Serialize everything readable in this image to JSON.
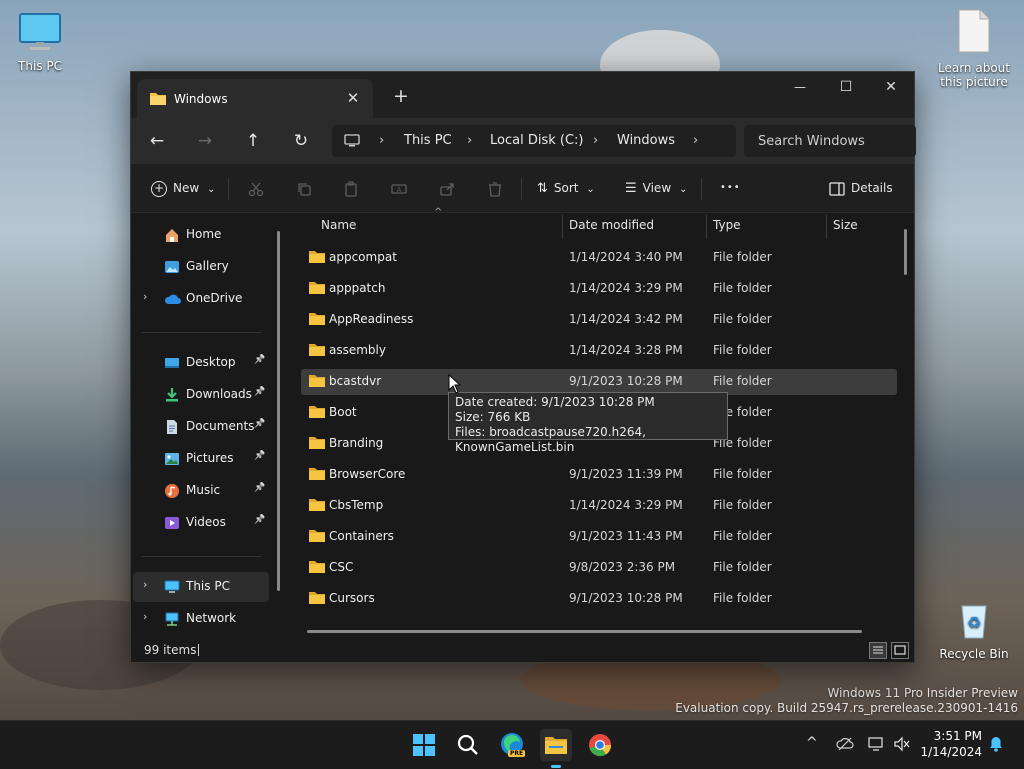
{
  "desktop": {
    "this_pc_label": "This PC",
    "learn_label": "Learn about this picture",
    "recycle_label": "Recycle Bin",
    "watermark_line1": "Windows 11 Pro Insider Preview",
    "watermark_line2": "Evaluation copy. Build 25947.rs_prerelease.230901-1416"
  },
  "window": {
    "tab_title": "Windows",
    "tab_close": "✕",
    "new_tab": "+",
    "minimize": "—",
    "maximize": "☐",
    "close": "✕"
  },
  "navbar": {
    "back": "←",
    "forward": "→",
    "up": "↑",
    "refresh": "↻",
    "breadcrumb": [
      "This PC",
      "Local Disk (C:)",
      "Windows"
    ],
    "chevron": "›",
    "search_placeholder": "Search Windows"
  },
  "commandbar": {
    "new_label": "New",
    "sort_label": "Sort",
    "view_label": "View",
    "more_label": "•••",
    "details_label": "Details",
    "caret": "⌄"
  },
  "sidebar": {
    "items": [
      {
        "label": "Home"
      },
      {
        "label": "Gallery"
      },
      {
        "label": "OneDrive"
      },
      {
        "label": "Desktop"
      },
      {
        "label": "Downloads"
      },
      {
        "label": "Documents"
      },
      {
        "label": "Pictures"
      },
      {
        "label": "Music"
      },
      {
        "label": "Videos"
      },
      {
        "label": "This PC"
      },
      {
        "label": "Network"
      }
    ],
    "expand_glyph": "›",
    "pin_glyph": "📌"
  },
  "columns": {
    "name": "Name",
    "date": "Date modified",
    "type": "Type",
    "size": "Size",
    "sort_indicator": "^"
  },
  "files": [
    {
      "name": "appcompat",
      "date": "1/14/2024 3:40 PM",
      "type": "File folder"
    },
    {
      "name": "apppatch",
      "date": "1/14/2024 3:29 PM",
      "type": "File folder"
    },
    {
      "name": "AppReadiness",
      "date": "1/14/2024 3:42 PM",
      "type": "File folder"
    },
    {
      "name": "assembly",
      "date": "1/14/2024 3:28 PM",
      "type": "File folder"
    },
    {
      "name": "bcastdvr",
      "date": "9/1/2023 10:28 PM",
      "type": "File folder"
    },
    {
      "name": "Boot",
      "date": "",
      "type": "File folder"
    },
    {
      "name": "Branding",
      "date": "",
      "type": "File folder"
    },
    {
      "name": "BrowserCore",
      "date": "9/1/2023 11:39 PM",
      "type": "File folder"
    },
    {
      "name": "CbsTemp",
      "date": "1/14/2024 3:29 PM",
      "type": "File folder"
    },
    {
      "name": "Containers",
      "date": "9/1/2023 11:43 PM",
      "type": "File folder"
    },
    {
      "name": "CSC",
      "date": "9/8/2023 2:36 PM",
      "type": "File folder"
    },
    {
      "name": "Cursors",
      "date": "9/1/2023 10:28 PM",
      "type": "File folder"
    }
  ],
  "tooltip": {
    "line1": "Date created: 9/1/2023 10:28 PM",
    "line2": "Size: 766 KB",
    "line3": "Files: broadcastpause720.h264, KnownGameList.bin"
  },
  "status": {
    "count": "99 items"
  },
  "taskbar": {
    "edge_badge": "PRE",
    "time": "3:51 PM",
    "date": "1/14/2024",
    "tray_chevron": "^"
  },
  "colors": {
    "folder": "#f5c542",
    "accent": "#4cc2ff",
    "window_bg": "#191919"
  }
}
